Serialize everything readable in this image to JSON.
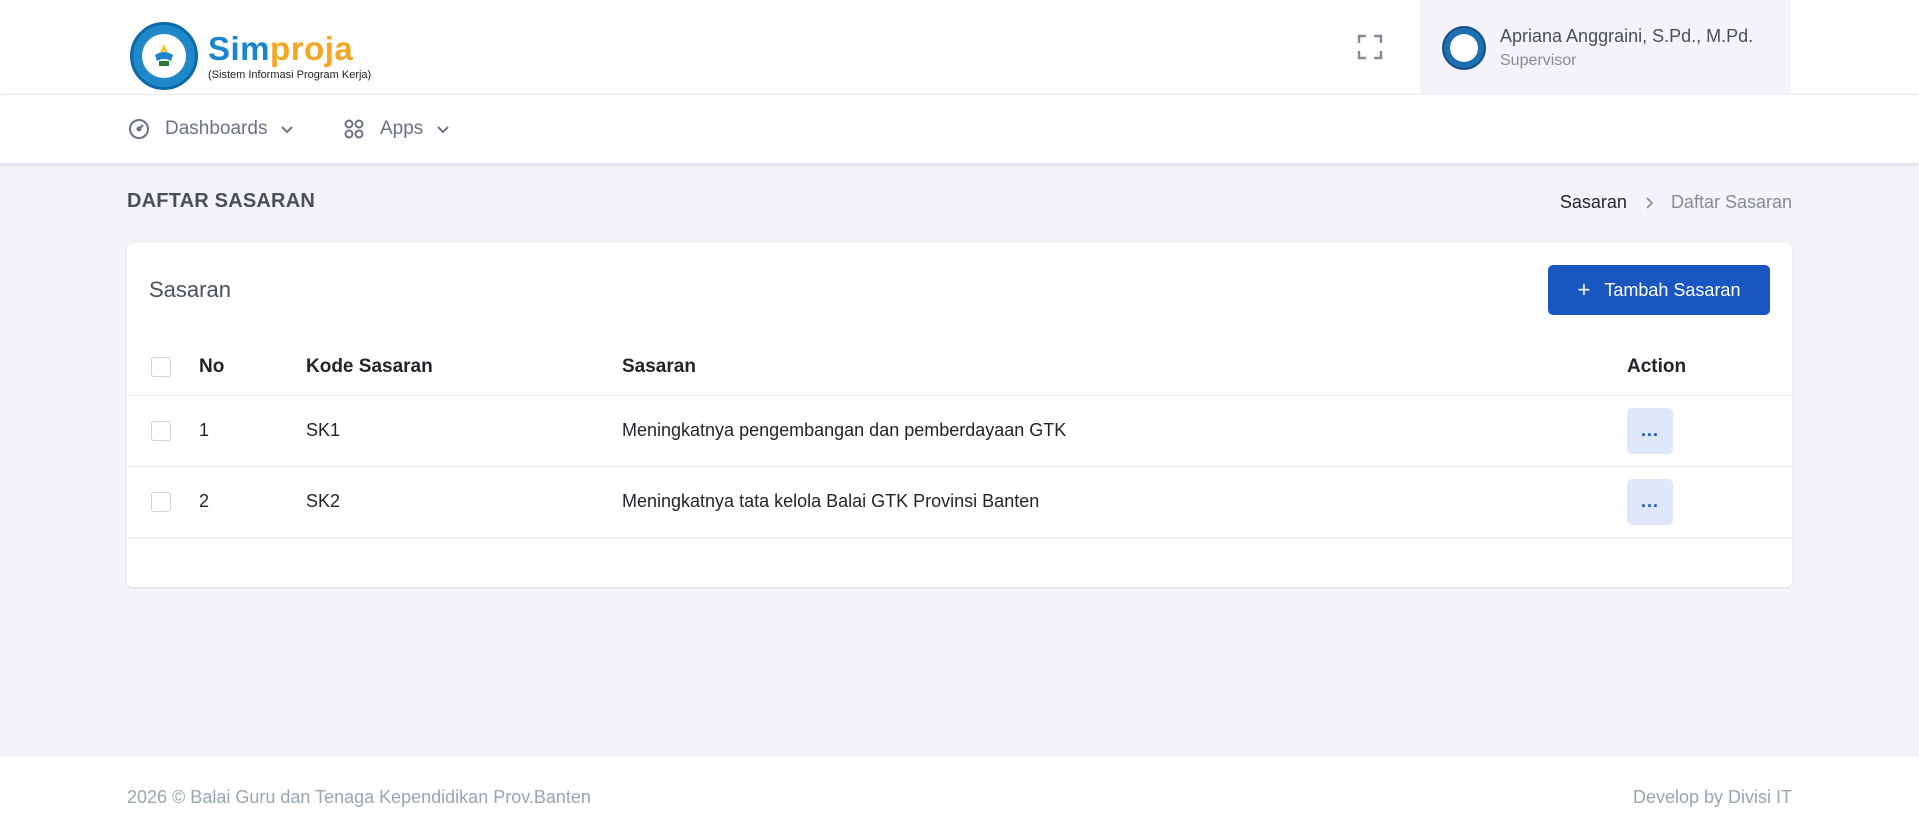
{
  "brand": {
    "title_part1": "Sim",
    "title_part2": "proja",
    "subtitle": "(Sistem Informasi Program Kerja)"
  },
  "user": {
    "name": "Apriana Anggraini, S.Pd., M.Pd.",
    "role": "Supervisor"
  },
  "nav": {
    "items": [
      {
        "label": "Dashboards",
        "icon": "speedometer-icon"
      },
      {
        "label": "Apps",
        "icon": "apps-grid-icon"
      }
    ]
  },
  "page": {
    "title": "DAFTAR SASARAN",
    "breadcrumb": {
      "parent": "Sasaran",
      "current": "Daftar Sasaran"
    }
  },
  "card": {
    "title": "Sasaran",
    "add_button_icon": "+",
    "add_button_label": "Tambah Sasaran"
  },
  "table": {
    "headers": {
      "no": "No",
      "kode": "Kode Sasaran",
      "sasaran": "Sasaran",
      "action": "Action"
    },
    "rows": [
      {
        "no": "1",
        "kode": "SK1",
        "sasaran": "Meningkatnya pengembangan dan pemberdayaan GTK",
        "action": "..."
      },
      {
        "no": "2",
        "kode": "SK2",
        "sasaran": "Meningkatnya tata kelola Balai GTK Provinsi Banten",
        "action": "..."
      }
    ]
  },
  "footer": {
    "left": "2026 © Balai Guru dan Tenaga Kependidikan Prov.Banten",
    "right": "Develop by Divisi IT"
  },
  "colors": {
    "primary": "#1a56c0",
    "brand_blue": "#1a86d0",
    "brand_orange": "#f5a623",
    "page_bg": "#f3f3f9"
  }
}
